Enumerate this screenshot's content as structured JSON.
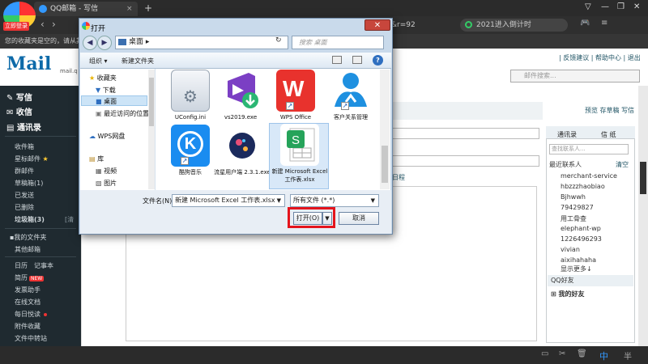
{
  "browser": {
    "tab_title": "QQ邮箱 - 写信",
    "login_badge": "立即登录",
    "url_fragment": "&r=92",
    "search_text": "2021进入倒计时",
    "favorites_bar_text": "您的收藏夹是空的，请从其他"
  },
  "mail": {
    "logo_text": "Mail",
    "logo_subtext": "mail.q",
    "top_links": "| 反馈建议 | 帮助中心 | 退出",
    "search_placeholder": "邮件搜索...",
    "sidebar": {
      "write": "写信",
      "inbox": "收信",
      "contacts": "通讯录",
      "items": [
        "收件箱",
        "星标邮件",
        "群邮件",
        "草稿箱(1)",
        "已发送",
        "已删除",
        "垃圾箱(3)"
      ],
      "trash_clear": "[清",
      "my_folders": "我的文件夹",
      "other_mail": "其他邮箱",
      "calendar": "日历",
      "notes": "记事本",
      "resume": "简历",
      "new_badge": "NEW",
      "send_helper": "发票助手",
      "online_docs": "在线文档",
      "daily": "每日悦读",
      "attachments": "附件收藏",
      "transfer": "文件中转站"
    },
    "content_links": "预览  存草稿  写信",
    "schedule": "日程",
    "right_panel": {
      "tab_contacts": "通讯录",
      "tab_letter": "信 纸",
      "search_placeholder": "查找联系人...",
      "recent_label": "最近联系人",
      "clear": "清空",
      "contacts": [
        "merchant-service",
        "hbzzzhaobiao",
        "Bjhwwh",
        "79429827",
        "用工骨查",
        "elephant-wp",
        "1226496293",
        "vivian",
        "aixihahaha",
        "显示更多↓"
      ],
      "qq_friends": "QQ好友",
      "my_friends": "我的好友"
    }
  },
  "dialog": {
    "title": "打开",
    "address": "桌面",
    "search_placeholder": "搜索 桌面",
    "toolbar": {
      "organize": "组织 ▾",
      "new_folder": "新建文件夹"
    },
    "nav": {
      "favorites": "收藏夹",
      "downloads": "下载",
      "desktop": "桌面",
      "recent": "最近访问的位置",
      "wps": "WPS网盘",
      "library": "库",
      "video": "视频",
      "pictures": "图片"
    },
    "files": [
      {
        "label": "UConfig.ini",
        "icon": "config-file-icon"
      },
      {
        "label": "vs2019.exe",
        "icon": "visual-studio-icon"
      },
      {
        "label": "WPS Office",
        "icon": "wps-office-icon"
      },
      {
        "label": "客户关系管理",
        "icon": "crm-app-icon"
      },
      {
        "label": "酷狗音乐",
        "icon": "kugou-music-icon"
      },
      {
        "label": "流星用户端 2.3.1.exe",
        "icon": "meteor-client-icon"
      },
      {
        "label": "新建 Microsoft Excel 工作表.xlsx",
        "icon": "excel-file-icon"
      }
    ],
    "filename_label": "文件名(N):",
    "filename_value": "新建 Microsoft Excel 工作表.xlsx",
    "filetype_value": "所有文件 (*.*)",
    "open_button": "打开(O)",
    "cancel_button": "取消"
  },
  "colors": {
    "highlight": "#e4141c",
    "sidebar_bg": "#1f2a30",
    "dialog_frame": "#c9daeb"
  }
}
